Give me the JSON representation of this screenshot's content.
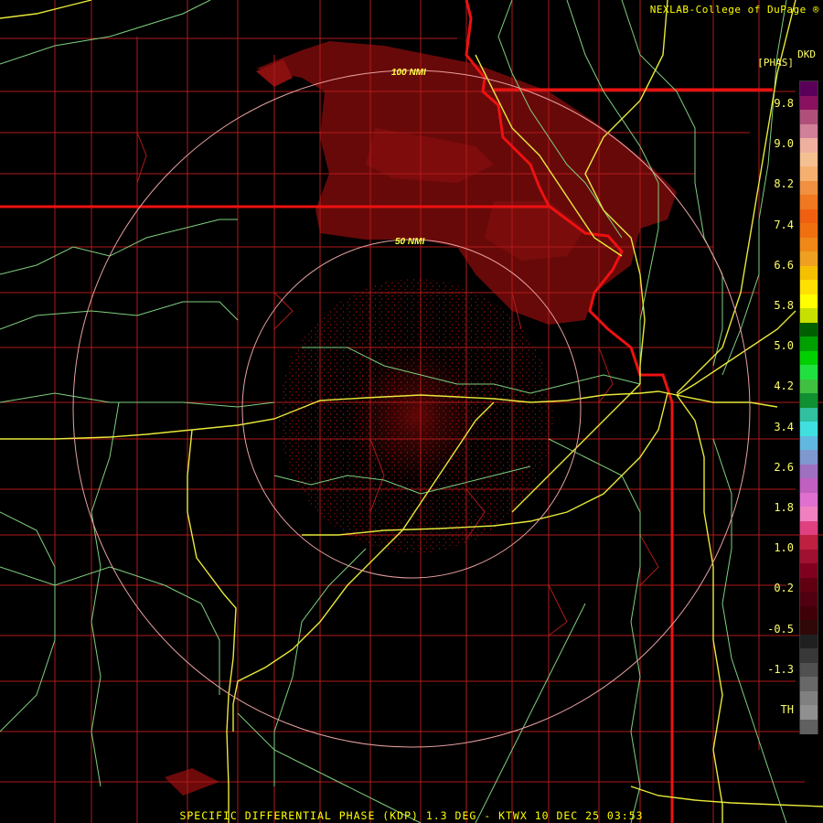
{
  "credit": "NEXLAB-College of DuPage",
  "credit_mark": "®",
  "product_code": "DKD",
  "product_unit": "[PHAS]",
  "caption": "SPECIFIC DIFFERENTIAL PHASE (KDP) 1.3 DEG - KTWX 10 DEC 25 03:53",
  "range_rings": [
    {
      "label": "50 NMI"
    },
    {
      "label": "100 NMI"
    }
  ],
  "legend": {
    "labels": [
      "9.8",
      "9.0",
      "8.2",
      "7.4",
      "6.6",
      "5.8",
      "5.0",
      "4.2",
      "3.4",
      "2.6",
      "1.8",
      "1.0",
      "0.2",
      "-0.5",
      "-1.3",
      "TH"
    ],
    "colors": [
      "#5a005a",
      "#8a1060",
      "#b0507a",
      "#d08098",
      "#f0b0a0",
      "#f5c090",
      "#f5b070",
      "#f09040",
      "#f07820",
      "#f06010",
      "#f07010",
      "#f08818",
      "#f0a020",
      "#f5c000",
      "#ffe000",
      "#ffff00",
      "#c8e000",
      "#006000",
      "#00a000",
      "#00d000",
      "#20e040",
      "#40c040",
      "#109030",
      "#30c0a0",
      "#40e0e0",
      "#60b8e0",
      "#8098d0",
      "#a070c0",
      "#c060c0",
      "#e070d0",
      "#f080c0",
      "#e04080",
      "#c02040",
      "#a01030",
      "#800020",
      "#600010",
      "#500010",
      "#400008",
      "#300808",
      "#202020",
      "#383838",
      "#505050",
      "#686868",
      "#808080",
      "#909090",
      "#606060"
    ]
  },
  "colors": {
    "county_lines": "#cc2222",
    "state_lines": "#ee1111",
    "roads": "#eeee44",
    "rivers": "#88dd88",
    "rings": "#e8a0a0",
    "echo": "#7a0a0a"
  }
}
